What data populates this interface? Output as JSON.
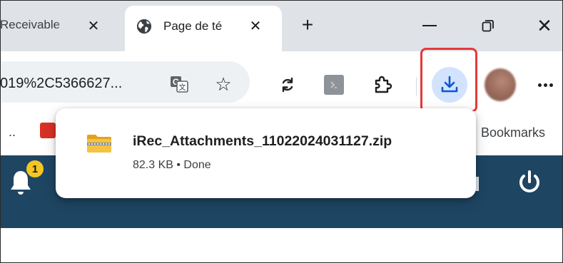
{
  "tabs": [
    {
      "title": "Receivable",
      "close": "✕",
      "active": false
    },
    {
      "title": "Page de té",
      "close": "✕",
      "active": true,
      "favicon": "globe-icon"
    }
  ],
  "tabstrip": {
    "new_tab": "+",
    "minimize": "minimize-icon",
    "restore": "restore-icon",
    "close": "✕"
  },
  "toolbar": {
    "url": "019%2C5366627...",
    "icons": [
      "translate-icon",
      "star-icon",
      "sync-icon",
      "extension-icon",
      "puzzle-icon",
      "download-icon",
      "avatar",
      "menu-icon"
    ],
    "star": "☆"
  },
  "bookmarks_bar": {
    "overflow": "..",
    "label": "Bookmarks"
  },
  "download_popup": {
    "file_name": "iRec_Attachments_11022024031127.zip",
    "meta": "82.3 KB • Done",
    "icon": "zip-folder-icon"
  },
  "page": {
    "notification_count": "1",
    "icons": [
      "bell-icon",
      "power-icon"
    ]
  },
  "colors": {
    "tabstrip_bg": "#dfe3e8",
    "header_bg": "#1e4562",
    "download_accent": "#0b57d0",
    "download_btn_bg": "#d3e3fd",
    "highlight": "#e5393a",
    "badge": "#f3c623"
  }
}
